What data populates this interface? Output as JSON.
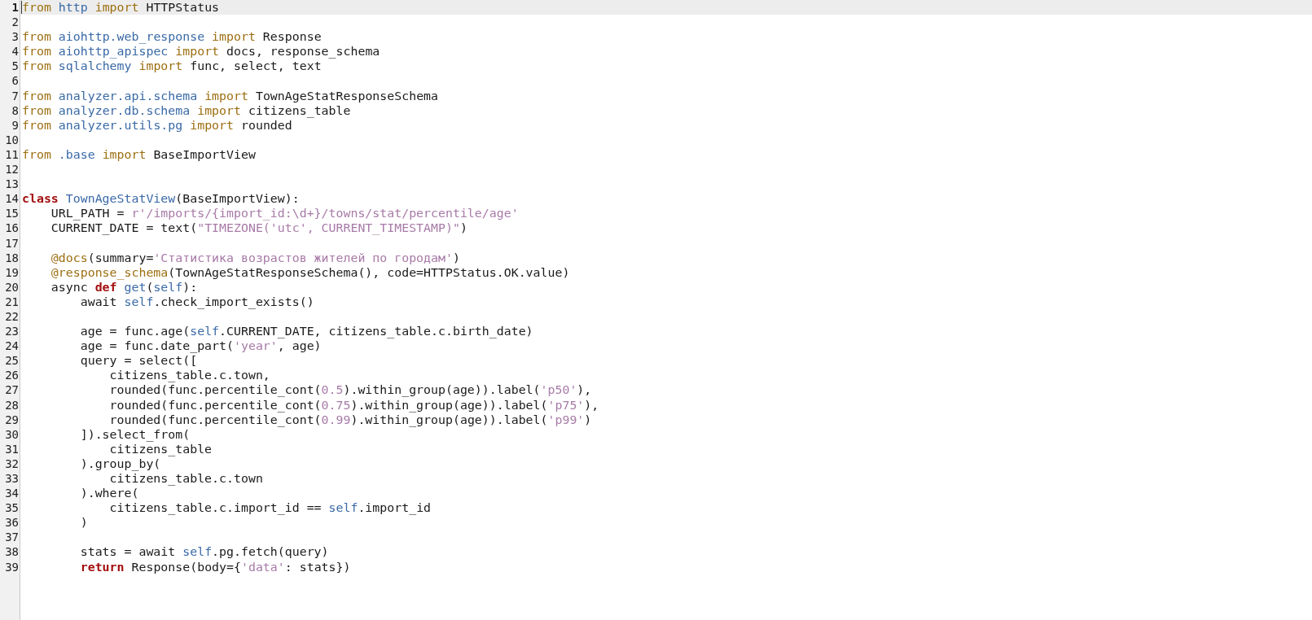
{
  "editor": {
    "lines": [
      {
        "number": "1",
        "current": true,
        "tokens": [
          {
            "t": "from",
            "kind": "kw"
          },
          {
            "t": " http",
            "kind": "name"
          },
          {
            "t": " import",
            "kind": "kw"
          },
          {
            "t": " HTTPStatus",
            "kind": "plain"
          }
        ]
      },
      {
        "number": "2",
        "current": false
      },
      {
        "number": "3",
        "current": false,
        "tokens": [
          {
            "t": "from",
            "kind": "kw"
          },
          {
            "t": " aiohttp.web_response",
            "kind": "name"
          },
          {
            "t": " import",
            "kind": "kw"
          },
          {
            "t": " Response",
            "kind": "plain"
          }
        ]
      },
      {
        "number": "4",
        "current": false,
        "tokens": [
          {
            "t": "from",
            "kind": "kw"
          },
          {
            "t": " aiohttp_apispec",
            "kind": "name"
          },
          {
            "t": " import",
            "kind": "kw"
          },
          {
            "t": " docs, response_schema",
            "kind": "plain"
          }
        ]
      },
      {
        "number": "5",
        "current": false,
        "tokens": [
          {
            "t": "from",
            "kind": "kw"
          },
          {
            "t": " sqlalchemy",
            "kind": "name"
          },
          {
            "t": " import",
            "kind": "kw"
          },
          {
            "t": " func, select, text",
            "kind": "plain"
          }
        ]
      },
      {
        "number": "6",
        "current": false
      },
      {
        "number": "7",
        "current": false,
        "tokens": [
          {
            "t": "from",
            "kind": "kw"
          },
          {
            "t": " analyzer.api.schema",
            "kind": "name"
          },
          {
            "t": " import",
            "kind": "kw"
          },
          {
            "t": " TownAgeStatResponseSchema",
            "kind": "plain"
          }
        ]
      },
      {
        "number": "8",
        "current": false,
        "tokens": [
          {
            "t": "from",
            "kind": "kw"
          },
          {
            "t": " analyzer.db.schema",
            "kind": "name"
          },
          {
            "t": " import",
            "kind": "kw"
          },
          {
            "t": " citizens_table",
            "kind": "plain"
          }
        ]
      },
      {
        "number": "9",
        "current": false,
        "tokens": [
          {
            "t": "from",
            "kind": "kw"
          },
          {
            "t": " analyzer.utils.pg",
            "kind": "name"
          },
          {
            "t": " import",
            "kind": "kw"
          },
          {
            "t": " rounded",
            "kind": "plain"
          }
        ]
      },
      {
        "number": "10",
        "current": false
      },
      {
        "number": "11",
        "current": false,
        "tokens": [
          {
            "t": "from",
            "kind": "kw"
          },
          {
            "t": " .base",
            "kind": "name"
          },
          {
            "t": " import",
            "kind": "kw"
          },
          {
            "t": " BaseImportView",
            "kind": "plain"
          }
        ]
      },
      {
        "number": "12",
        "current": false
      },
      {
        "number": "13",
        "current": false
      },
      {
        "number": "14",
        "current": false,
        "tokens": [
          {
            "t": "class",
            "kind": "strong"
          },
          {
            "t": " TownAgeStatView",
            "kind": "name"
          },
          {
            "t": "(BaseImportView):",
            "kind": "plain"
          }
        ]
      },
      {
        "number": "15",
        "current": false,
        "tokens": [
          {
            "t": "    URL_PATH = ",
            "kind": "plain"
          },
          {
            "t": "r'/imports/{import_id:\\d+}/towns/stat/percentile/age'",
            "kind": "str"
          }
        ]
      },
      {
        "number": "16",
        "current": false,
        "tokens": [
          {
            "t": "    CURRENT_DATE = text(",
            "kind": "plain"
          },
          {
            "t": "\"TIMEZONE('utc', CURRENT_TIMESTAMP)\"",
            "kind": "str"
          },
          {
            "t": ")",
            "kind": "plain"
          }
        ]
      },
      {
        "number": "17",
        "current": false
      },
      {
        "number": "18",
        "current": false,
        "tokens": [
          {
            "t": "    @docs",
            "kind": "kw"
          },
          {
            "t": "(summary=",
            "kind": "plain"
          },
          {
            "t": "'Статистика возрастов жителей по городам'",
            "kind": "str"
          },
          {
            "t": ")",
            "kind": "plain"
          }
        ]
      },
      {
        "number": "19",
        "current": false,
        "tokens": [
          {
            "t": "    @response_schema",
            "kind": "kw"
          },
          {
            "t": "(TownAgeStatResponseSchema(), code=HTTPStatus.OK.value)",
            "kind": "plain"
          }
        ]
      },
      {
        "number": "20",
        "current": false,
        "tokens": [
          {
            "t": "    async ",
            "kind": "plain"
          },
          {
            "t": "def",
            "kind": "strong"
          },
          {
            "t": " get",
            "kind": "name"
          },
          {
            "t": "(",
            "kind": "plain"
          },
          {
            "t": "self",
            "kind": "name"
          },
          {
            "t": "):",
            "kind": "plain"
          }
        ]
      },
      {
        "number": "21",
        "current": false,
        "tokens": [
          {
            "t": "        await ",
            "kind": "plain"
          },
          {
            "t": "self",
            "kind": "name"
          },
          {
            "t": ".check_import_exists()",
            "kind": "plain"
          }
        ]
      },
      {
        "number": "22",
        "current": false
      },
      {
        "number": "23",
        "current": false,
        "tokens": [
          {
            "t": "        age = func.age(",
            "kind": "plain"
          },
          {
            "t": "self",
            "kind": "name"
          },
          {
            "t": ".CURRENT_DATE, citizens_table.c.birth_date)",
            "kind": "plain"
          }
        ]
      },
      {
        "number": "24",
        "current": false,
        "tokens": [
          {
            "t": "        age = func.date_part(",
            "kind": "plain"
          },
          {
            "t": "'year'",
            "kind": "str"
          },
          {
            "t": ", age)",
            "kind": "plain"
          }
        ]
      },
      {
        "number": "25",
        "current": false,
        "tokens": [
          {
            "t": "        query = select([",
            "kind": "plain"
          }
        ]
      },
      {
        "number": "26",
        "current": false,
        "tokens": [
          {
            "t": "            citizens_table.c.town,",
            "kind": "plain"
          }
        ]
      },
      {
        "number": "27",
        "current": false,
        "tokens": [
          {
            "t": "            rounded(func.percentile_cont(",
            "kind": "plain"
          },
          {
            "t": "0.5",
            "kind": "str"
          },
          {
            "t": ").within_group(age)).label(",
            "kind": "plain"
          },
          {
            "t": "'p50'",
            "kind": "str"
          },
          {
            "t": "),",
            "kind": "plain"
          }
        ]
      },
      {
        "number": "28",
        "current": false,
        "tokens": [
          {
            "t": "            rounded(func.percentile_cont(",
            "kind": "plain"
          },
          {
            "t": "0.75",
            "kind": "str"
          },
          {
            "t": ").within_group(age)).label(",
            "kind": "plain"
          },
          {
            "t": "'p75'",
            "kind": "str"
          },
          {
            "t": "),",
            "kind": "plain"
          }
        ]
      },
      {
        "number": "29",
        "current": false,
        "tokens": [
          {
            "t": "            rounded(func.percentile_cont(",
            "kind": "plain"
          },
          {
            "t": "0.99",
            "kind": "str"
          },
          {
            "t": ").within_group(age)).label(",
            "kind": "plain"
          },
          {
            "t": "'p99'",
            "kind": "str"
          },
          {
            "t": ")",
            "kind": "plain"
          }
        ]
      },
      {
        "number": "30",
        "current": false,
        "tokens": [
          {
            "t": "        ]).select_from(",
            "kind": "plain"
          }
        ]
      },
      {
        "number": "31",
        "current": false,
        "tokens": [
          {
            "t": "            citizens_table",
            "kind": "plain"
          }
        ]
      },
      {
        "number": "32",
        "current": false,
        "tokens": [
          {
            "t": "        ).group_by(",
            "kind": "plain"
          }
        ]
      },
      {
        "number": "33",
        "current": false,
        "tokens": [
          {
            "t": "            citizens_table.c.town",
            "kind": "plain"
          }
        ]
      },
      {
        "number": "34",
        "current": false,
        "tokens": [
          {
            "t": "        ).where(",
            "kind": "plain"
          }
        ]
      },
      {
        "number": "35",
        "current": false,
        "tokens": [
          {
            "t": "            citizens_table.c.import_id == ",
            "kind": "plain"
          },
          {
            "t": "self",
            "kind": "name"
          },
          {
            "t": ".import_id",
            "kind": "plain"
          }
        ]
      },
      {
        "number": "36",
        "current": false,
        "tokens": [
          {
            "t": "        )",
            "kind": "plain"
          }
        ]
      },
      {
        "number": "37",
        "current": false
      },
      {
        "number": "38",
        "current": false,
        "tokens": [
          {
            "t": "        stats = await ",
            "kind": "plain"
          },
          {
            "t": "self",
            "kind": "name"
          },
          {
            "t": ".pg.fetch(query)",
            "kind": "plain"
          }
        ]
      },
      {
        "number": "39",
        "current": false,
        "tokens": [
          {
            "t": "        return",
            "kind": "strong"
          },
          {
            "t": " Response(body={",
            "kind": "plain"
          },
          {
            "t": "'data'",
            "kind": "str"
          },
          {
            "t": ": stats})",
            "kind": "plain"
          }
        ]
      }
    ]
  }
}
